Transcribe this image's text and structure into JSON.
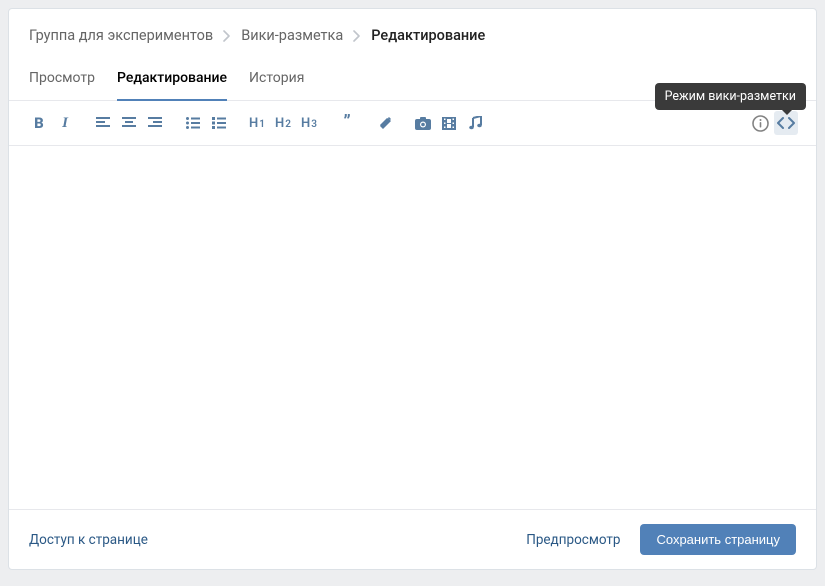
{
  "breadcrumbs": {
    "group": "Группа для экспериментов",
    "section": "Вики-разметка",
    "current": "Редактирование"
  },
  "tabs": {
    "preview": "Просмотр",
    "edit": "Редактирование",
    "history": "История"
  },
  "toolbar": {
    "bold": "B",
    "italic": "I",
    "h1": {
      "h": "H",
      "n": "1"
    },
    "h2": {
      "h": "H",
      "n": "2"
    },
    "h3": {
      "h": "H",
      "n": "3"
    }
  },
  "tooltip": "Режим вики-разметки",
  "footer": {
    "access": "Доступ к странице",
    "preview": "Предпросмотр",
    "save": "Сохранить страницу"
  }
}
